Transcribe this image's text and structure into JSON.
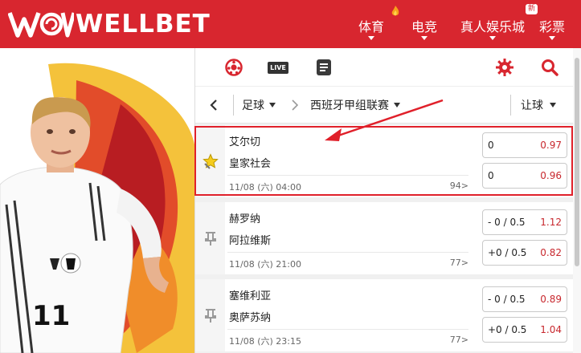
{
  "brand": {
    "name": "WELLBET"
  },
  "nav": [
    {
      "label": "体育"
    },
    {
      "label": "电竞"
    },
    {
      "label": "真人娱乐城",
      "badge": "新"
    },
    {
      "label": "彩票"
    }
  ],
  "toolbar": {
    "live_label": "LIVE"
  },
  "filter": {
    "sport": "足球",
    "league": "西班牙甲组联赛",
    "market": "让球"
  },
  "matches": [
    {
      "home": "艾尔切",
      "away": "皇家社会",
      "time": "11/08 (六) 04:00",
      "more": "94>",
      "odds": [
        {
          "line": "0",
          "price": "0.97"
        },
        {
          "line": "0",
          "price": "0.96"
        }
      ]
    },
    {
      "home": "赫罗纳",
      "away": "阿拉维斯",
      "time": "11/08 (六) 21:00",
      "more": "77>",
      "odds": [
        {
          "line": "- 0 / 0.5",
          "price": "1.12"
        },
        {
          "line": "+0 / 0.5",
          "price": "0.82"
        }
      ]
    },
    {
      "home": "塞维利亚",
      "away": "奥萨苏纳",
      "time": "11/08 (六) 23:15",
      "more": "77>",
      "odds": [
        {
          "line": "- 0 / 0.5",
          "price": "0.89"
        },
        {
          "line": "+0 / 0.5",
          "price": "1.04"
        }
      ]
    }
  ],
  "colors": {
    "brand_red": "#d8262f",
    "price_red": "#c8282e",
    "highlight": "#e0202a"
  },
  "icons": {
    "favorite_active": "star-icon",
    "favorite_inactive": "pin-icon"
  }
}
